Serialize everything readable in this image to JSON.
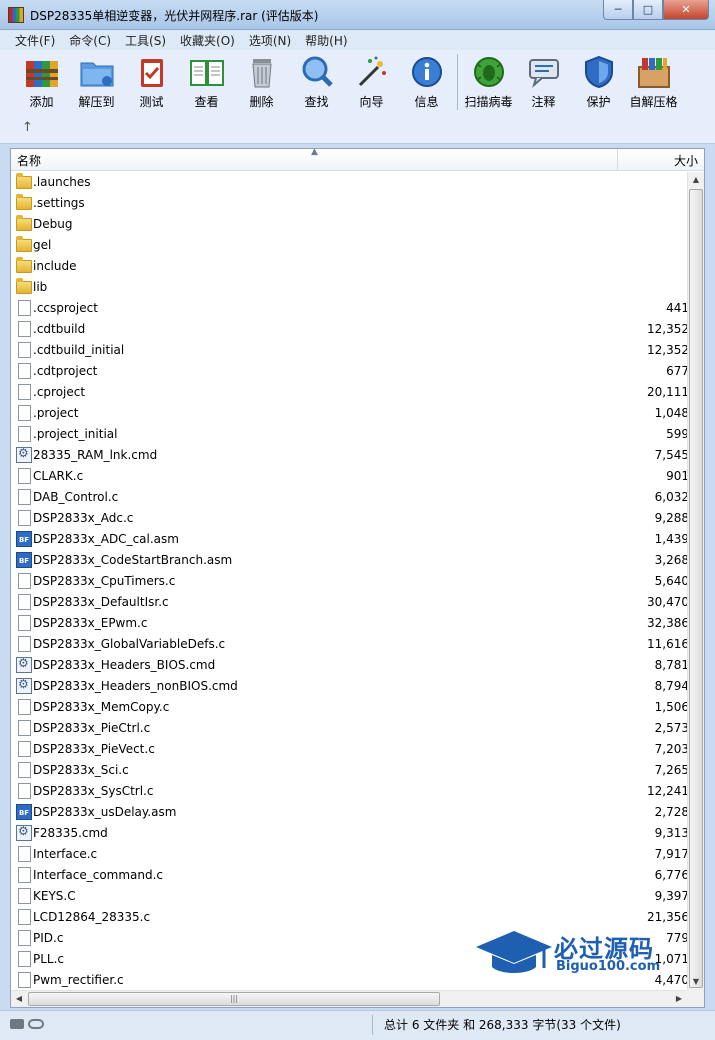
{
  "window": {
    "title": "DSP28335单相逆变器，光伏并网程序.rar (评估版本)",
    "minimize": "─",
    "maximize": "□",
    "close": "✕"
  },
  "menu": [
    "文件(F)",
    "命令(C)",
    "工具(S)",
    "收藏夹(O)",
    "选项(N)",
    "帮助(H)"
  ],
  "toolbar": {
    "items": [
      {
        "label": "添加",
        "icon": "add-books-icon"
      },
      {
        "label": "解压到",
        "icon": "extract-folder-icon"
      },
      {
        "label": "测试",
        "icon": "test-clipboard-icon"
      },
      {
        "label": "查看",
        "icon": "view-book-icon"
      },
      {
        "label": "删除",
        "icon": "trash-icon"
      },
      {
        "label": "查找",
        "icon": "magnifier-icon"
      },
      {
        "label": "向导",
        "icon": "wizard-wand-icon"
      },
      {
        "label": "信息",
        "icon": "info-icon"
      },
      {
        "label": "扫描病毒",
        "icon": "virus-scan-icon"
      },
      {
        "label": "注释",
        "icon": "comment-icon"
      },
      {
        "label": "保护",
        "icon": "shield-icon"
      },
      {
        "label": "自解压格",
        "icon": "sfx-box-icon"
      }
    ],
    "up_arrow": "↑"
  },
  "columns": {
    "name": "名称",
    "size": "大小",
    "sort_glyph": "▲"
  },
  "files": [
    {
      "name": ".launches",
      "type": "folder",
      "size": ""
    },
    {
      "name": ".settings",
      "type": "folder",
      "size": ""
    },
    {
      "name": "Debug",
      "type": "folder",
      "size": ""
    },
    {
      "name": "gel",
      "type": "folder",
      "size": ""
    },
    {
      "name": "include",
      "type": "folder",
      "size": ""
    },
    {
      "name": "lib",
      "type": "folder",
      "size": ""
    },
    {
      "name": ".ccsproject",
      "type": "file",
      "size": "441"
    },
    {
      "name": ".cdtbuild",
      "type": "file",
      "size": "12,352"
    },
    {
      "name": ".cdtbuild_initial",
      "type": "file",
      "size": "12,352"
    },
    {
      "name": ".cdtproject",
      "type": "file",
      "size": "677"
    },
    {
      "name": ".cproject",
      "type": "file",
      "size": "20,111"
    },
    {
      "name": ".project",
      "type": "file",
      "size": "1,048"
    },
    {
      "name": ".project_initial",
      "type": "file",
      "size": "599"
    },
    {
      "name": "28335_RAM_lnk.cmd",
      "type": "cmd",
      "size": "7,545"
    },
    {
      "name": "CLARK.c",
      "type": "file",
      "size": "901"
    },
    {
      "name": "DAB_Control.c",
      "type": "file",
      "size": "6,032"
    },
    {
      "name": "DSP2833x_Adc.c",
      "type": "file",
      "size": "9,288"
    },
    {
      "name": "DSP2833x_ADC_cal.asm",
      "type": "asm",
      "size": "1,439"
    },
    {
      "name": "DSP2833x_CodeStartBranch.asm",
      "type": "asm",
      "size": "3,268"
    },
    {
      "name": "DSP2833x_CpuTimers.c",
      "type": "file",
      "size": "5,640"
    },
    {
      "name": "DSP2833x_DefaultIsr.c",
      "type": "file",
      "size": "30,470"
    },
    {
      "name": "DSP2833x_EPwm.c",
      "type": "file",
      "size": "32,386"
    },
    {
      "name": "DSP2833x_GlobalVariableDefs.c",
      "type": "file",
      "size": "11,616"
    },
    {
      "name": "DSP2833x_Headers_BIOS.cmd",
      "type": "cmd",
      "size": "8,781"
    },
    {
      "name": "DSP2833x_Headers_nonBIOS.cmd",
      "type": "cmd",
      "size": "8,794"
    },
    {
      "name": "DSP2833x_MemCopy.c",
      "type": "file",
      "size": "1,506"
    },
    {
      "name": "DSP2833x_PieCtrl.c",
      "type": "file",
      "size": "2,573"
    },
    {
      "name": "DSP2833x_PieVect.c",
      "type": "file",
      "size": "7,203"
    },
    {
      "name": "DSP2833x_Sci.c",
      "type": "file",
      "size": "7,265"
    },
    {
      "name": "DSP2833x_SysCtrl.c",
      "type": "file",
      "size": "12,241"
    },
    {
      "name": "DSP2833x_usDelay.asm",
      "type": "asm",
      "size": "2,728"
    },
    {
      "name": "F28335.cmd",
      "type": "cmd",
      "size": "9,313"
    },
    {
      "name": "Interface.c",
      "type": "file",
      "size": "7,917"
    },
    {
      "name": "Interface_command.c",
      "type": "file",
      "size": "6,776"
    },
    {
      "name": "KEYS.C",
      "type": "file",
      "size": "9,397"
    },
    {
      "name": "LCD12864_28335.c",
      "type": "file",
      "size": "21,356"
    },
    {
      "name": "PID.c",
      "type": "file",
      "size": "779"
    },
    {
      "name": "PLL.c",
      "type": "file",
      "size": "1,071"
    },
    {
      "name": "Pwm_rectifier.c",
      "type": "file",
      "size": "4,470"
    }
  ],
  "watermark": {
    "title": "必过源码",
    "url": "Biguo100.com"
  },
  "status": {
    "summary": "总计 6 文件夹 和 268,333 字节(33 个文件)"
  },
  "scroll": {
    "up": "▲",
    "down": "▼",
    "left": "◀",
    "right": "▶",
    "grip": "|||"
  }
}
